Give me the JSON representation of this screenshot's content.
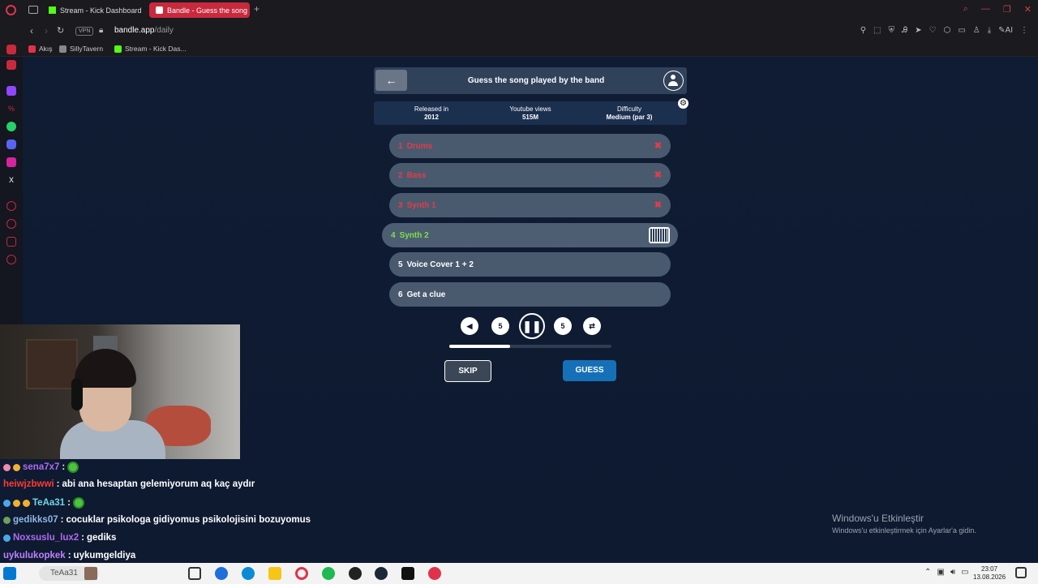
{
  "browser": {
    "tabs": [
      {
        "label": "Stream - Kick Dashboard",
        "fav_color": "#53fc18"
      },
      {
        "label": "Bandle - Guess the song",
        "fav_color": "#ffffff"
      }
    ],
    "vpn_label": "VPN",
    "url_host": "bandle.app",
    "url_path": "/daily",
    "bookmarks": [
      {
        "label": "Akış",
        "fav_color": "#e0334b"
      },
      {
        "label": "SillyTavern",
        "fav_color": "#888888"
      },
      {
        "label": "Stream - Kick Das...",
        "fav_color": "#53fc18"
      }
    ]
  },
  "game": {
    "title": "Guess the song played by the band",
    "info": [
      {
        "label": "Released in",
        "value": "2012"
      },
      {
        "label": "Youtube views",
        "value": "515M"
      },
      {
        "label": "Difficulty",
        "value": "Medium (par 3)"
      }
    ],
    "rows": [
      {
        "num": "1",
        "label": "Drums",
        "state": "failed"
      },
      {
        "num": "2",
        "label": "Bass",
        "state": "failed"
      },
      {
        "num": "3",
        "label": "Synth 1",
        "state": "failed"
      },
      {
        "num": "4",
        "label": "Synth 2",
        "state": "active"
      },
      {
        "num": "5",
        "label": "Voice Cover 1 + 2",
        "state": "normal"
      },
      {
        "num": "6",
        "label": "Get a clue",
        "state": "normal"
      }
    ],
    "controls": {
      "rewind_label": "5",
      "forward_label": "5",
      "progress_fraction": 0.375
    },
    "skip_label": "SKIP",
    "guess_label": "GUESS"
  },
  "windows_watermark": {
    "line1": "Windows'u Etkinleştir",
    "line2": "Windows'u etkinleştirmek için Ayarlar'a gidin."
  },
  "chat": [
    {
      "user": "sena7x7",
      "user_color": "#b06af0",
      "message": "",
      "emote": true
    },
    {
      "user": "heiwjzbwwi",
      "user_color": "#ff3b30",
      "message": "abi ana hesaptan gelemiyorum aq kaç aydır",
      "emote": false
    },
    {
      "user": "TeAa31",
      "user_color": "#6fd6e8",
      "message": "",
      "emote": true
    },
    {
      "user": "gedikks07",
      "user_color": "#8fb8e8",
      "message": "cocuklar psikologa gidiyomus psikolojisini bozuyomus",
      "emote": false
    },
    {
      "user": "Noxsuslu_lux2",
      "user_color": "#b06af0",
      "message": "gediks",
      "emote": false
    },
    {
      "user": "uykulukopkek",
      "user_color": "#c080ff",
      "message": "uykumgeldiya",
      "emote": false
    }
  ],
  "taskbar": {
    "search_text": "TeAa31",
    "time": "23:07",
    "date": "13.08.2026"
  }
}
